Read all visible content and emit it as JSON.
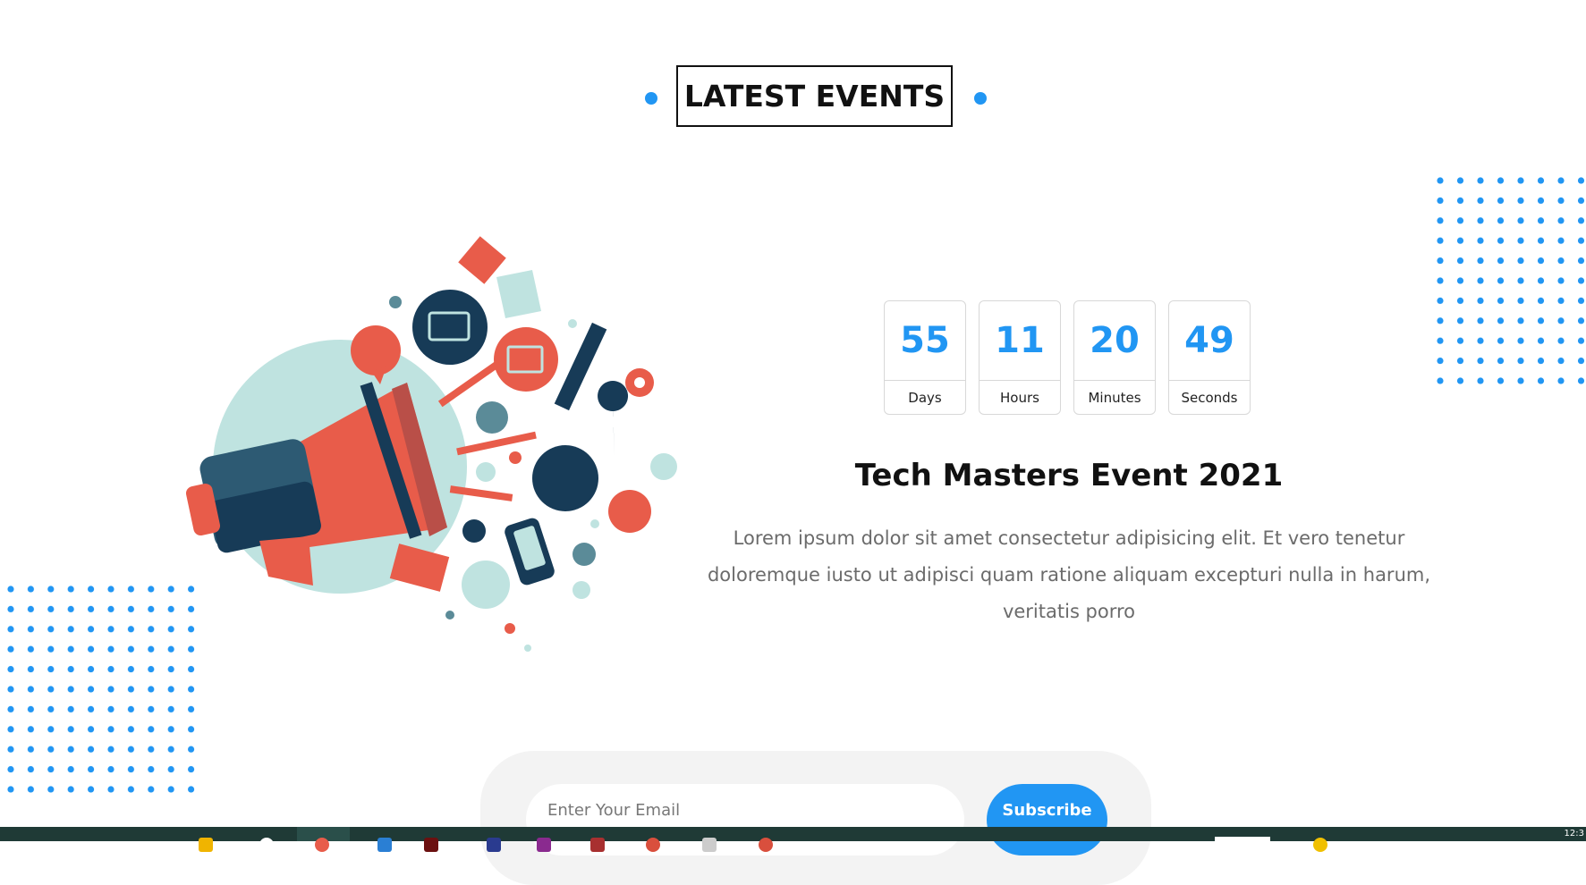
{
  "section": {
    "title": "LATEST EVENTS"
  },
  "countdown": [
    {
      "value": "55",
      "label": "Days"
    },
    {
      "value": "11",
      "label": "Hours"
    },
    {
      "value": "20",
      "label": "Minutes"
    },
    {
      "value": "49",
      "label": "Seconds"
    }
  ],
  "event": {
    "title": "Tech Masters Event 2021",
    "description": "Lorem ipsum dolor sit amet consectetur adipisicing elit. Et vero tenetur doloremque iusto ut adipisci quam ratione aliquam excepturi nulla in harum, veritatis porro"
  },
  "subscribe": {
    "placeholder": "Enter Your Email",
    "button_label": "Subscribe"
  },
  "colors": {
    "accent": "#2196f3",
    "illustration_red": "#e85c4a",
    "illustration_navy": "#173b57",
    "illustration_mint": "#bfe3e0",
    "taskbar": "#1f3a36"
  },
  "illustration": {
    "icon": "megaphone-icon"
  }
}
